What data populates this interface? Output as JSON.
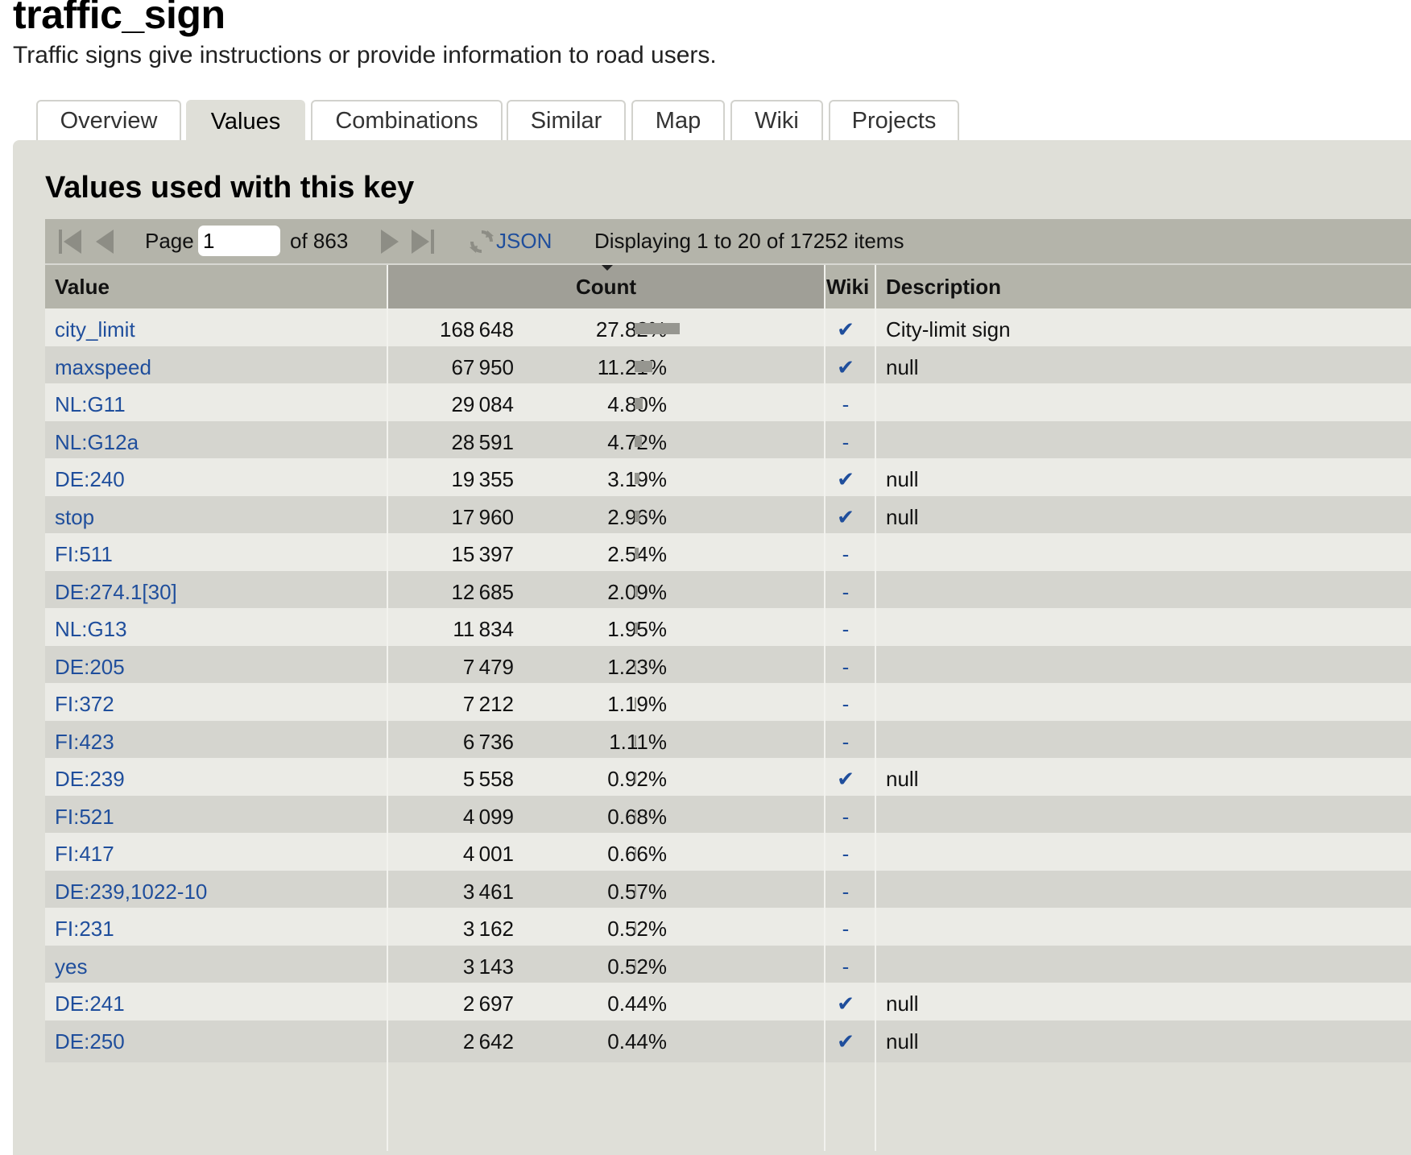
{
  "header": {
    "title": "traffic_sign",
    "subtitle": "Traffic signs give instructions or provide information to road users."
  },
  "tabs": [
    {
      "label": "Overview",
      "active": false
    },
    {
      "label": "Values",
      "active": true
    },
    {
      "label": "Combinations",
      "active": false
    },
    {
      "label": "Similar",
      "active": false
    },
    {
      "label": "Map",
      "active": false
    },
    {
      "label": "Wiki",
      "active": false
    },
    {
      "label": "Projects",
      "active": false
    }
  ],
  "section_title": "Values used with this key",
  "pager": {
    "page_label": "Page",
    "page_value": "1",
    "of_label": "of 863",
    "json_label": "JSON",
    "display_text": "Displaying 1 to 20 of 17252 items"
  },
  "table": {
    "headers": {
      "value": "Value",
      "count": "Count",
      "wiki": "Wiki",
      "description": "Description"
    },
    "sorted_column": "count",
    "rows": [
      {
        "value": "city_limit",
        "count": "168 648",
        "percent": "27.82%",
        "fraction": 0.2782,
        "wiki": "✔",
        "description": "City-limit sign"
      },
      {
        "value": "maxspeed",
        "count": "67 950",
        "percent": "11.21%",
        "fraction": 0.1121,
        "wiki": "✔",
        "description": "null"
      },
      {
        "value": "NL:G11",
        "count": "29 084",
        "percent": "4.80%",
        "fraction": 0.048,
        "wiki": "-",
        "description": ""
      },
      {
        "value": "NL:G12a",
        "count": "28 591",
        "percent": "4.72%",
        "fraction": 0.0472,
        "wiki": "-",
        "description": ""
      },
      {
        "value": "DE:240",
        "count": "19 355",
        "percent": "3.19%",
        "fraction": 0.0319,
        "wiki": "✔",
        "description": "null"
      },
      {
        "value": "stop",
        "count": "17 960",
        "percent": "2.96%",
        "fraction": 0.0296,
        "wiki": "✔",
        "description": "null"
      },
      {
        "value": "FI:511",
        "count": "15 397",
        "percent": "2.54%",
        "fraction": 0.0254,
        "wiki": "-",
        "description": ""
      },
      {
        "value": "DE:274.1[30]",
        "count": "12 685",
        "percent": "2.09%",
        "fraction": 0.0209,
        "wiki": "-",
        "description": ""
      },
      {
        "value": "NL:G13",
        "count": "11 834",
        "percent": "1.95%",
        "fraction": 0.0195,
        "wiki": "-",
        "description": ""
      },
      {
        "value": "DE:205",
        "count": "7 479",
        "percent": "1.23%",
        "fraction": 0.0123,
        "wiki": "-",
        "description": ""
      },
      {
        "value": "FI:372",
        "count": "7 212",
        "percent": "1.19%",
        "fraction": 0.0119,
        "wiki": "-",
        "description": ""
      },
      {
        "value": "FI:423",
        "count": "6 736",
        "percent": "1.11%",
        "fraction": 0.0111,
        "wiki": "-",
        "description": ""
      },
      {
        "value": "DE:239",
        "count": "5 558",
        "percent": "0.92%",
        "fraction": 0.0092,
        "wiki": "✔",
        "description": "null"
      },
      {
        "value": "FI:521",
        "count": "4 099",
        "percent": "0.68%",
        "fraction": 0.0068,
        "wiki": "-",
        "description": ""
      },
      {
        "value": "FI:417",
        "count": "4 001",
        "percent": "0.66%",
        "fraction": 0.0066,
        "wiki": "-",
        "description": ""
      },
      {
        "value": "DE:239,1022-10",
        "count": "3 461",
        "percent": "0.57%",
        "fraction": 0.0057,
        "wiki": "-",
        "description": ""
      },
      {
        "value": "FI:231",
        "count": "3 162",
        "percent": "0.52%",
        "fraction": 0.0052,
        "wiki": "-",
        "description": ""
      },
      {
        "value": "yes",
        "count": "3 143",
        "percent": "0.52%",
        "fraction": 0.0052,
        "wiki": "-",
        "description": ""
      },
      {
        "value": "DE:241",
        "count": "2 697",
        "percent": "0.44%",
        "fraction": 0.0044,
        "wiki": "✔",
        "description": "null"
      },
      {
        "value": "DE:250",
        "count": "2 642",
        "percent": "0.44%",
        "fraction": 0.0044,
        "wiki": "✔",
        "description": "null"
      }
    ]
  }
}
